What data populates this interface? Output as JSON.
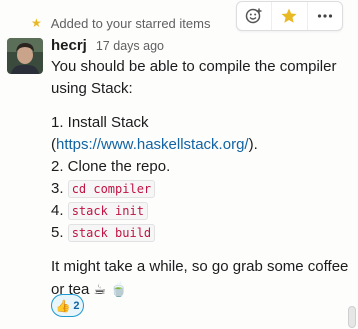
{
  "starred_banner": {
    "text": "Added to your starred items"
  },
  "message": {
    "author": "hecrj",
    "timestamp": "17 days ago",
    "intro": "You should be able to compile the compiler using Stack:",
    "step1_prefix": "1. Install Stack",
    "step1_link_open": "(",
    "step1_link": "https://www.haskellstack.org/",
    "step1_link_close": ").",
    "step2": "2. Clone the repo.",
    "step3_num": "3.",
    "step3_code": "cd compiler",
    "step4_num": "4.",
    "step4_code": "stack init",
    "step5_num": "5.",
    "step5_code": "stack build",
    "outro": "It might take a while, so go grab some coffee or tea",
    "outro_emojis": "☕ 🍵"
  },
  "reaction": {
    "emoji": "👍",
    "count": "2"
  },
  "actions": {
    "items": [
      "add-reaction-icon",
      "star-icon",
      "more-icon"
    ]
  },
  "colors": {
    "link": "#1264a3",
    "code": "#c01343",
    "star": "#e8b923",
    "reaction_border": "#1d9bd1"
  }
}
